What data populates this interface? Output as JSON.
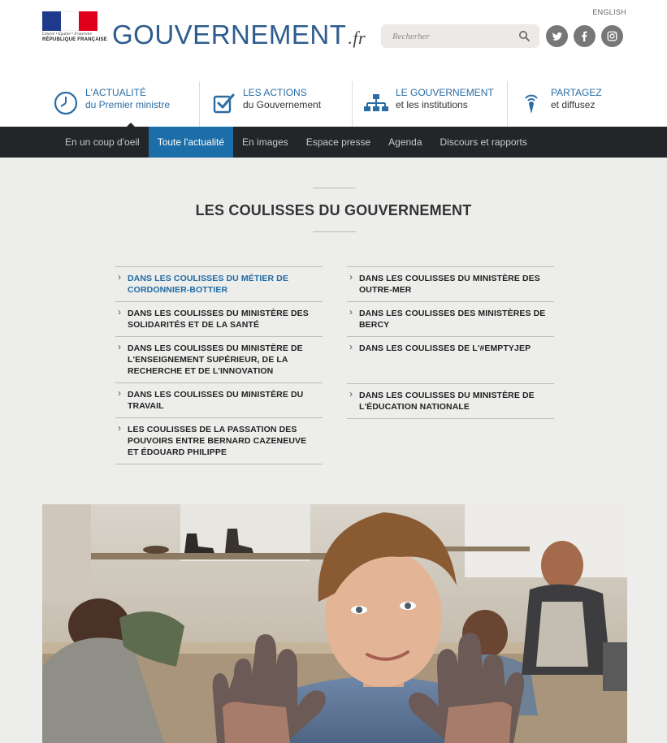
{
  "header": {
    "logo_motto": "Liberté • Égalité • Fraternité",
    "logo_org": "RÉPUBLIQUE FRANÇAISE",
    "brand_main": "GOUVERNEMENT",
    "brand_tld": ".fr",
    "lang_link": "ENGLISH",
    "search_placeholder": "Recherher",
    "social": [
      {
        "icon": "twitter-icon",
        "glyph": "t"
      },
      {
        "icon": "facebook-icon",
        "glyph": "f"
      },
      {
        "icon": "instagram-icon",
        "glyph": "◎"
      }
    ]
  },
  "mainnav": [
    {
      "line1": "L'ACTUALITÉ",
      "line2": "du Premier ministre",
      "icon": "clock-icon"
    },
    {
      "line1": "LES ACTIONS",
      "line2": "du Gouvernement",
      "icon": "checkbox-icon"
    },
    {
      "line1": "LE GOUVERNEMENT",
      "line2": "et les institutions",
      "icon": "org-chart-icon"
    },
    {
      "line1": "PARTAGEZ",
      "line2": "et diffusez",
      "icon": "broadcast-icon"
    }
  ],
  "subnav": [
    {
      "label": "En un coup d'oeil",
      "active": false
    },
    {
      "label": "Toute l'actualité",
      "active": true
    },
    {
      "label": "En images",
      "active": false
    },
    {
      "label": "Espace presse",
      "active": false
    },
    {
      "label": "Agenda",
      "active": false
    },
    {
      "label": "Discours et rapports",
      "active": false
    }
  ],
  "section": {
    "title": "LES COULISSES DU GOUVERNEMENT",
    "left_items": [
      "DANS LES COULISSES DU MÉTIER DE CORDONNIER-BOTTIER",
      "DANS LES COULISSES DU MINISTÈRE DES SOLIDARITÉS ET DE LA SANTÉ",
      "DANS LES COULISSES DU MINISTÈRE DE L'ENSEIGNEMENT SUPÉRIEUR, DE LA RECHERCHE ET DE L'INNOVATION",
      "DANS LES COULISSES DU MINISTÈRE DU TRAVAIL",
      "LES COULISSES DE LA PASSATION DES POUVOIRS ENTRE BERNARD CAZENEUVE ET ÉDOUARD PHILIPPE"
    ],
    "right_items": [
      "DANS LES COULISSES DU MINISTÈRE DES OUTRE-MER",
      "DANS LES COULISSES DES MINISTÈRES DE BERCY",
      "DANS LES COULISSES DE L'#EMPTYJEP",
      "DANS LES COULISSES DU MINISTÈRE DE L'ÉDUCATION NATIONALE"
    ]
  },
  "colors": {
    "brand_blue": "#2e5c8f",
    "link_blue": "#1f6aa6",
    "subnav_bg": "#232629",
    "subnav_active": "#1c6ea8",
    "content_bg": "#ededeb"
  }
}
